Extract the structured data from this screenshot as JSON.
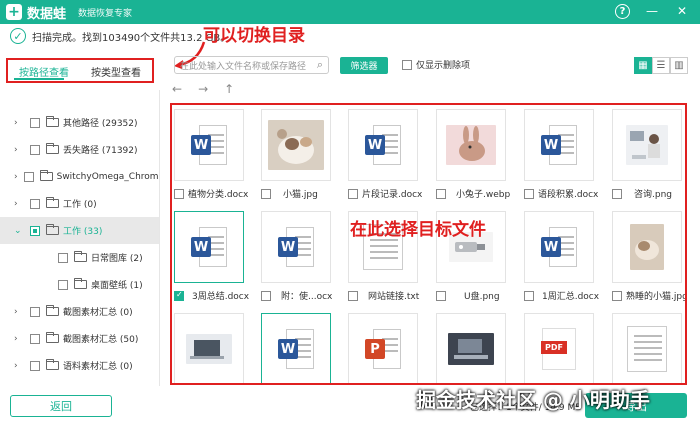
{
  "app": {
    "name": "数据蛙",
    "subtitle": "数据恢复专家",
    "logo_glyph": "+"
  },
  "window": {
    "help": "?",
    "minimize": "—",
    "close": "✕"
  },
  "status": {
    "text": "扫描完成。找到103490个文件共13.2 GB。"
  },
  "annotations": {
    "switch_dir": "可以切换目录",
    "select_target": "在此选择目标文件"
  },
  "tabs": [
    {
      "label": "按路径查看",
      "active": true
    },
    {
      "label": "按类型查看",
      "active": false
    }
  ],
  "search": {
    "placeholder": "在此处输入文件名称或保存路径"
  },
  "filter_label": "筛选器",
  "only_deleted_label": "仅显示删除项",
  "tree": [
    {
      "label": "其他路径 (29352)"
    },
    {
      "label": "丢失路径 (71392)"
    },
    {
      "label": "SwitchyOmega_Chromium"
    },
    {
      "label": "工作 (0)"
    },
    {
      "label": "工作 (33)"
    },
    {
      "label": "日常图库 (2)"
    },
    {
      "label": "桌面壁纸 (1)"
    },
    {
      "label": "截图素材汇总 (0)"
    },
    {
      "label": "截图素材汇总 (50)"
    },
    {
      "label": "语料素材汇总 (0)"
    }
  ],
  "files": [
    {
      "name": "植物分类.docx",
      "type": "word"
    },
    {
      "name": "小猫.jpg",
      "type": "photo-cat"
    },
    {
      "name": "片段记录.docx",
      "type": "word"
    },
    {
      "name": "小兔子.webp",
      "type": "photo-rabbit"
    },
    {
      "name": "语段积累.docx",
      "type": "word"
    },
    {
      "name": "咨询.png",
      "type": "photo-office"
    },
    {
      "name": "3周总结.docx",
      "type": "word"
    },
    {
      "name": "附：使...ocx",
      "type": "word"
    },
    {
      "name": "网站链接.txt",
      "type": "doc"
    },
    {
      "name": "U盘.png",
      "type": "photo-usb"
    },
    {
      "name": "1周汇总.docx",
      "type": "word"
    },
    {
      "name": "熟睡的小猫.jpg",
      "type": "photo-kitten"
    },
    {
      "name": "",
      "type": "photo-laptop"
    },
    {
      "name": "",
      "type": "word"
    },
    {
      "name": "",
      "type": "ppt"
    },
    {
      "name": "",
      "type": "photo-desk"
    },
    {
      "name": "",
      "type": "pdf"
    },
    {
      "name": "",
      "type": "doc"
    }
  ],
  "bottom": {
    "back_label": "返回",
    "summary": "已选择：1个文件/ 14.9 MB",
    "export_label": "导出"
  },
  "watermark": "掘金技术社区 @ 小明助手",
  "colors": {
    "accent": "#1ab394",
    "annotation": "#e02020",
    "word": "#2b579a",
    "ppt": "#d24726",
    "pdf": "#d93025"
  }
}
